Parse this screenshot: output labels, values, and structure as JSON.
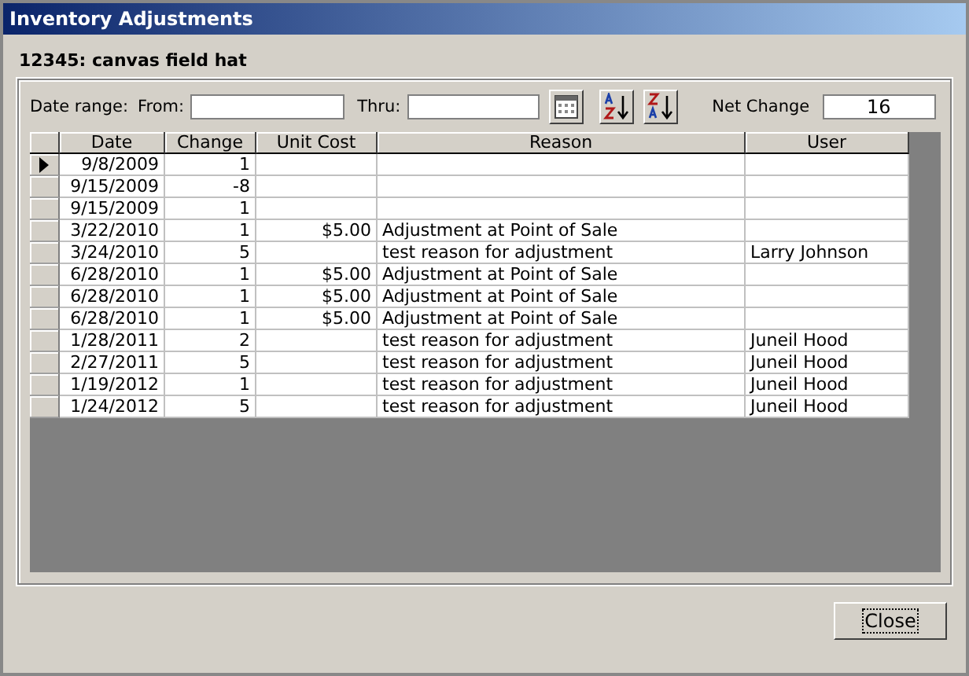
{
  "window": {
    "title": "Inventory Adjustments"
  },
  "item_heading": "12345: canvas field hat",
  "filter": {
    "date_range_label": "Date range:",
    "from_label": "From:",
    "thru_label": "Thru:",
    "net_change_label": "Net Change",
    "net_change": "16"
  },
  "table": {
    "columns": [
      "Date",
      "Change",
      "Unit Cost",
      "Reason",
      "User"
    ],
    "rows": [
      {
        "selected": true,
        "cells": [
          "9/8/2009",
          "1",
          "",
          "",
          ""
        ]
      },
      {
        "selected": false,
        "cells": [
          "9/15/2009",
          "-8",
          "",
          "",
          ""
        ]
      },
      {
        "selected": false,
        "cells": [
          "9/15/2009",
          "1",
          "",
          "",
          ""
        ]
      },
      {
        "selected": false,
        "cells": [
          "3/22/2010",
          "1",
          "$5.00",
          "Adjustment at Point of Sale",
          ""
        ]
      },
      {
        "selected": false,
        "cells": [
          "3/24/2010",
          "5",
          "",
          "test reason for adjustment",
          "Larry Johnson"
        ]
      },
      {
        "selected": false,
        "cells": [
          "6/28/2010",
          "1",
          "$5.00",
          "Adjustment at Point of Sale",
          ""
        ]
      },
      {
        "selected": false,
        "cells": [
          "6/28/2010",
          "1",
          "$5.00",
          "Adjustment at Point of Sale",
          ""
        ]
      },
      {
        "selected": false,
        "cells": [
          "6/28/2010",
          "1",
          "$5.00",
          "Adjustment at Point of Sale",
          ""
        ]
      },
      {
        "selected": false,
        "cells": [
          "1/28/2011",
          "2",
          "",
          "test reason for adjustment",
          "Juneil Hood"
        ]
      },
      {
        "selected": false,
        "cells": [
          "2/27/2011",
          "5",
          "",
          "test reason for adjustment",
          "Juneil Hood"
        ]
      },
      {
        "selected": false,
        "cells": [
          "1/19/2012",
          "1",
          "",
          "test reason for adjustment",
          "Juneil Hood"
        ]
      },
      {
        "selected": false,
        "cells": [
          "1/24/2012",
          "5",
          "",
          "test reason for adjustment",
          "Juneil Hood"
        ]
      }
    ]
  },
  "buttons": {
    "close": "Close"
  }
}
